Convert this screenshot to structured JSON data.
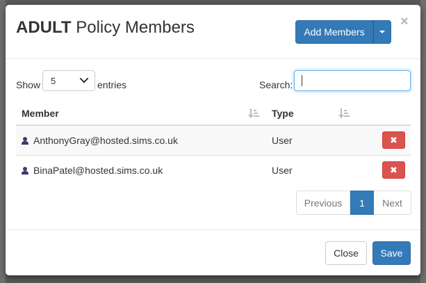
{
  "modal": {
    "title_strong": "ADULT",
    "title_rest": "Policy Members",
    "close_symbol": "×"
  },
  "header": {
    "add_members_label": "Add Members"
  },
  "controls": {
    "show_label": "Show",
    "entries_value": "5",
    "entries_label": "entries",
    "search_label": "Search:",
    "search_value": ""
  },
  "table": {
    "columns": [
      "Member",
      "Type"
    ],
    "rows": [
      {
        "member": "AnthonyGray@hosted.sims.co.uk",
        "type": "User"
      },
      {
        "member": "BinaPatel@hosted.sims.co.uk",
        "type": "User"
      }
    ],
    "delete_symbol": "✖"
  },
  "pagination": {
    "previous_label": "Previous",
    "current_page": "1",
    "next_label": "Next"
  },
  "footer": {
    "close_label": "Close",
    "save_label": "Save"
  },
  "colors": {
    "primary": "#337ab7",
    "danger": "#d9534f",
    "user_icon": "#3b3b6b"
  },
  "icons": {
    "caret": "caret-down-icon",
    "sort": "sort-icon",
    "user": "user-icon",
    "delete": "times-icon",
    "select_chevron": "chevron-down-icon"
  }
}
